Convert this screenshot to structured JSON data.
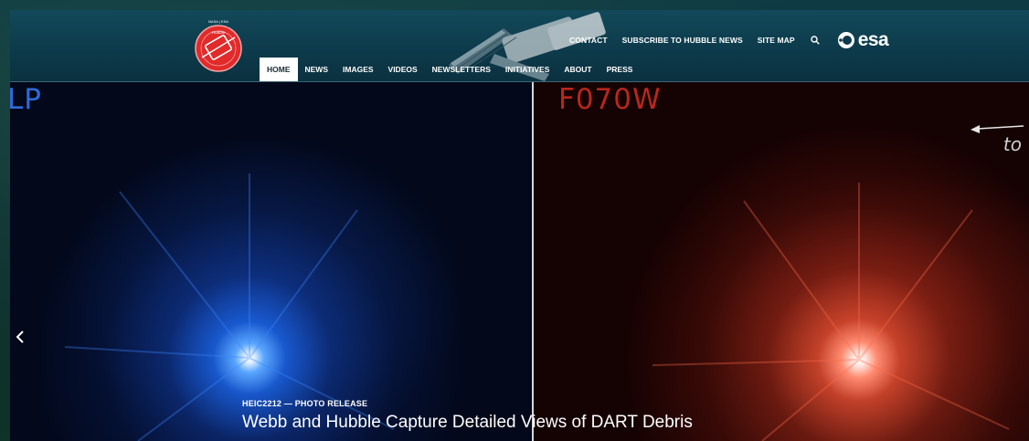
{
  "header": {
    "logo_alt": "NASA | ESA Hubble",
    "top_links": [
      "CONTACT",
      "SUBSCRIBE TO HUBBLE NEWS",
      "SITE MAP"
    ],
    "search_icon": "search-icon",
    "esa_text": "esa",
    "main_nav": [
      "HOME",
      "NEWS",
      "IMAGES",
      "VIDEOS",
      "NEWSLETTERS",
      "INITIATIVES",
      "ABOUT",
      "PRESS"
    ],
    "active_nav": "HOME"
  },
  "slide": {
    "left_filter": "LP",
    "right_filter": "F070W",
    "arrow_note": "to",
    "prev_icon": "chevron-left-icon",
    "kicker": "HEIC2212 — PHOTO RELEASE",
    "title": "Webb and Hubble Capture Detailed Views of DART Debris"
  },
  "colors": {
    "header_bg": "#0d3a4a",
    "left_glow": "#2d6cd8",
    "right_glow": "#e0503a",
    "left_label": "#2d6cd8",
    "right_label": "#b8271c"
  }
}
